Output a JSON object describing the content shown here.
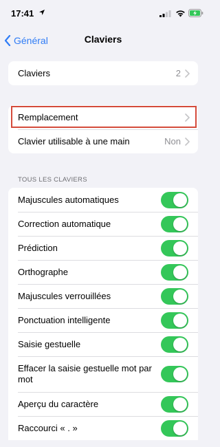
{
  "status_bar": {
    "time": "17:41"
  },
  "nav": {
    "back_label": "Général",
    "title": "Claviers"
  },
  "group1": {
    "label": "Claviers",
    "value": "2"
  },
  "group2": {
    "rows": [
      {
        "label": "Remplacement",
        "value": ""
      },
      {
        "label": "Clavier utilisable à une main",
        "value": "Non"
      }
    ]
  },
  "section_header": "TOUS LES CLAVIERS",
  "toggles": [
    {
      "label": "Majuscules automatiques",
      "on": true
    },
    {
      "label": "Correction automatique",
      "on": true
    },
    {
      "label": "Prédiction",
      "on": true
    },
    {
      "label": "Orthographe",
      "on": true
    },
    {
      "label": "Majuscules verrouillées",
      "on": true
    },
    {
      "label": "Ponctuation intelligente",
      "on": true
    },
    {
      "label": "Saisie gestuelle",
      "on": true
    },
    {
      "label": "Effacer la saisie gestuelle mot par mot",
      "on": true
    },
    {
      "label": "Aperçu du caractère",
      "on": true
    },
    {
      "label": "Raccourci « . »",
      "on": true
    }
  ],
  "colors": {
    "accent": "#2f7cf6",
    "toggle_on": "#34c759",
    "highlight": "#d44a3a"
  }
}
